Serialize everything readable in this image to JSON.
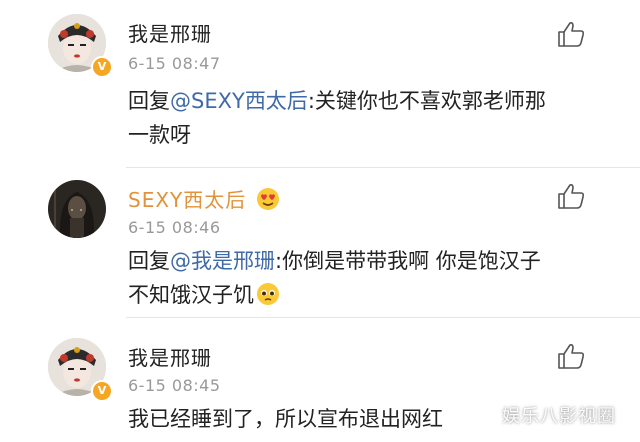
{
  "comments": [
    {
      "username": "我是邢珊",
      "timestamp": "6-15 08:47",
      "reply_prefix": "回复",
      "mention": "@SEXY西太后",
      "text_line1": ":关键你也不喜欢郭老师那",
      "text_line2": "一款呀",
      "verified": true
    },
    {
      "username": "SEXY西太后",
      "timestamp": "6-15 08:46",
      "reply_prefix": "回复",
      "mention": "@我是邢珊",
      "text_line1": ":你倒是带带我啊 你是饱汉子",
      "text_line2": "不知饿汉子饥",
      "username_emoji": "heart-eyes-emoji",
      "inline_emoji": "pleading-face-emoji",
      "verified": false
    },
    {
      "username": "我是邢珊",
      "timestamp": "6-15 08:45",
      "text_line1": "我已经睡到了，所以宣布退出网红",
      "verified": true
    }
  ],
  "watermark": "娱乐八影视圈",
  "colors": {
    "username_gold": "#e0933a",
    "mention_blue": "#3f6aa8",
    "timestamp_gray": "#999999",
    "verified_badge": "#f5a623"
  },
  "icons": {
    "like": "thumbs-up-outline-icon"
  }
}
